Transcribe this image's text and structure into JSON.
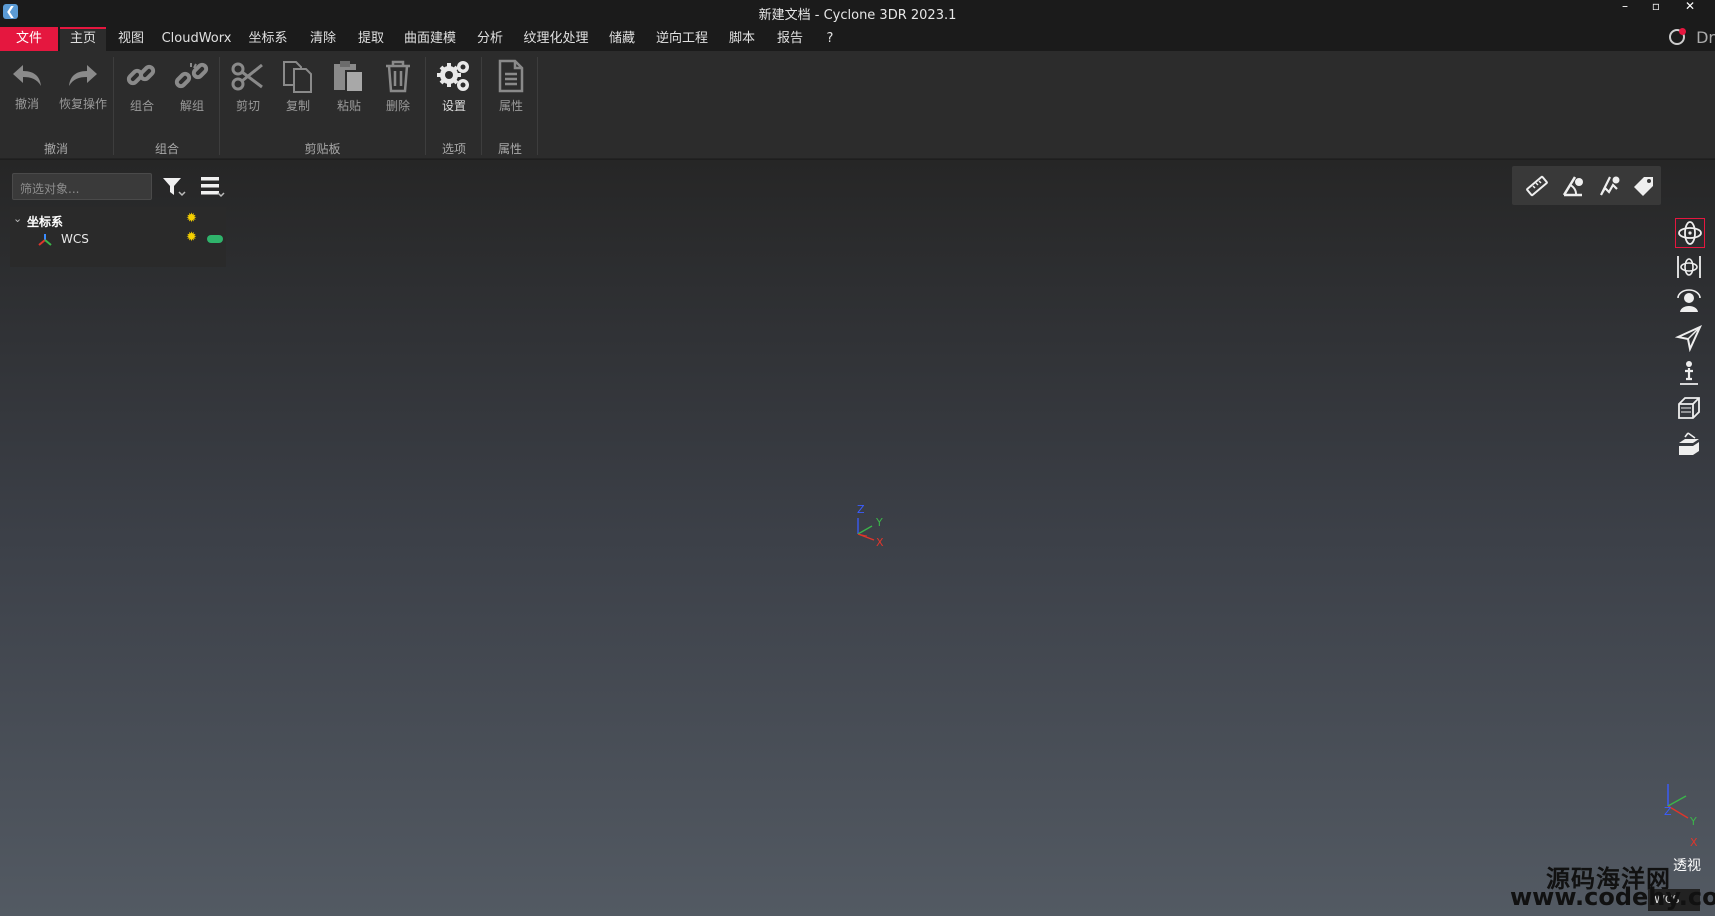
{
  "window": {
    "title": "新建文档 - Cyclone 3DR 2023.1",
    "minimize": "–",
    "maximize": "▫",
    "close": "✕"
  },
  "menu": {
    "tabs": [
      "文件",
      "主页",
      "视图",
      "CloudWorx",
      "坐标系",
      "清除",
      "提取",
      "曲面建模",
      "分析",
      "纹理化处理",
      "储藏",
      "逆向工程",
      "脚本",
      "报告",
      "?"
    ],
    "right_text": "Dr"
  },
  "ribbon": {
    "buttons": {
      "undo": "撤消",
      "redo": "恢复操作",
      "group": "组合",
      "ungroup": "解组",
      "cut": "剪切",
      "copy": "复制",
      "paste": "粘贴",
      "delete": "删除",
      "settings": "设置",
      "properties": "属性"
    },
    "groups": {
      "undo": "撤消",
      "group": "组合",
      "clipboard": "剪贴板",
      "options": "选项",
      "properties": "属性"
    }
  },
  "tree": {
    "filter_placeholder": "筛选对象...",
    "root": "坐标系",
    "child": "WCS"
  },
  "viewport": {
    "axis": {
      "x": "X",
      "y": "Y",
      "z": "Z"
    },
    "projection": "透视",
    "coord_badge": "WCS"
  },
  "watermark": {
    "line1": "源码海洋网",
    "line2": "www.codehy.com"
  },
  "colors": {
    "accent": "#e5173f",
    "toggle": "#2fb36b",
    "axis_x": "#e0352b",
    "axis_y": "#3bb54a",
    "axis_z": "#3a5cff"
  }
}
